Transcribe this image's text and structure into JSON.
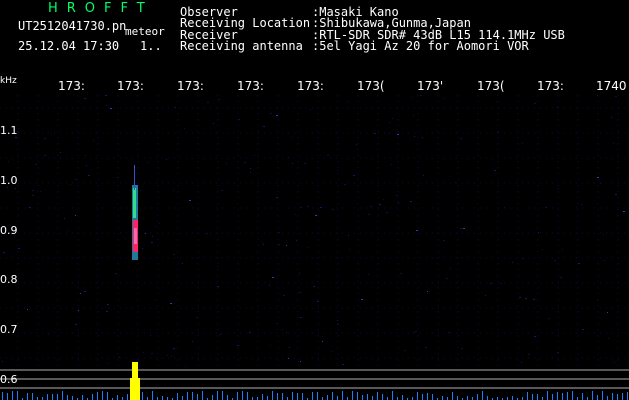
{
  "header": {
    "logo": "HROFFT",
    "filename": "UT2512041730.pn",
    "filetype": "meteor",
    "date": "25.12.04 17:30",
    "extra": "1..",
    "meta": [
      {
        "key": "Observer",
        "value": ":Masaki Kano"
      },
      {
        "key": "Receiving Location",
        "value": ":Shibukawa,Gunma,Japan"
      },
      {
        "key": "Receiver",
        "value": ":RTL-SDR SDR# 43dB L15 114.1MHz USB"
      },
      {
        "key": "Receiving antenna",
        "value": ":5el Yagi Az 20 for Aomori VOR"
      }
    ]
  },
  "axis": {
    "unit": "kHz",
    "x_ticks": [
      "173:",
      "173:",
      "173:",
      "173:",
      "173:",
      "173(",
      "173'",
      "173(",
      "173:",
      "1740"
    ],
    "y_ticks": [
      "1.1",
      "1.0",
      "0.9",
      "0.8",
      "0.7",
      "0.6"
    ]
  },
  "colors": {
    "background": "#000000",
    "grid": "#0a0a3a",
    "echo_core": "#ff2266",
    "echo_edge": "#33ccff",
    "reference_line": "#b0b0b0",
    "baseline_signal": "#ffff00",
    "baseline_noise": "#1a7fff"
  }
}
